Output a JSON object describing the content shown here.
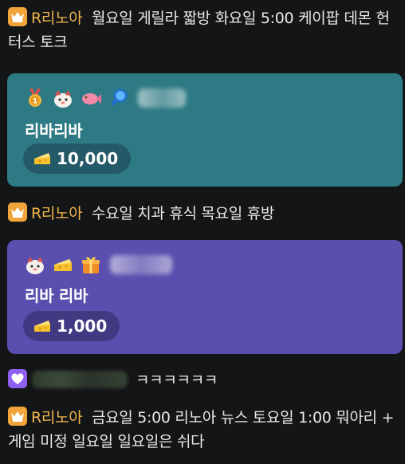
{
  "messages": [
    {
      "nickname": "R리노아",
      "text": "월요일 게릴라 짧방 화요일 5:00 케이팝 데몬 헌터스 토크"
    },
    {
      "nickname": "R리노아",
      "text": "수요일 치과 휴식 목요일 휴방"
    },
    {
      "text": "ㅋㅋㅋㅋㅋㅋ"
    },
    {
      "nickname": "R리노아",
      "text": "금요일 5:00 리노아 뉴스 토요일 1:00 뭐아리 + 게임 미정 일요일 일요일은 쉬다"
    }
  ],
  "donations": [
    {
      "message": "리바리바",
      "amount": "10,000",
      "color": "#2e7a84",
      "icons": [
        "medal-1-icon",
        "character-icon",
        "pink-fish-icon",
        "magnifier-icon"
      ]
    },
    {
      "message": "리바 리바",
      "amount": "1,000",
      "color": "#5a4fae",
      "icons": [
        "character-icon",
        "cheese-icon",
        "gift-box-icon"
      ]
    }
  ],
  "colors": {
    "background": "#141517",
    "nickname": "#f2b64a",
    "crown_badge": "#f0a43a",
    "heart_badge": "#8f5ff2"
  }
}
